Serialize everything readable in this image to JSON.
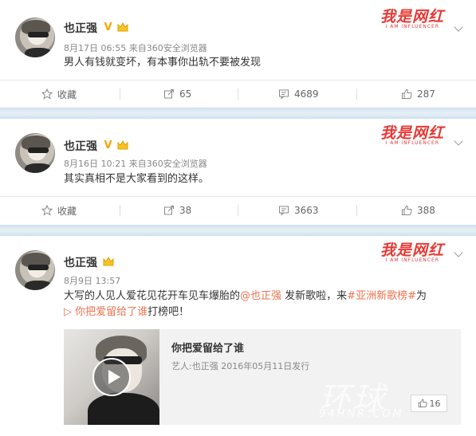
{
  "posts": [
    {
      "author": "也正强",
      "verified_badge": "V",
      "date": "8月17日 06:55",
      "source_prefix": "来自",
      "source": "360安全浏览器",
      "text": "男人有钱就变坏，有本事你出轨不要被发现",
      "watermark": "我是网红",
      "watermark_sub": "I AM INFLUENCER",
      "actions": {
        "favorite": "收藏",
        "repost": "65",
        "comment": "4689",
        "like": "287"
      }
    },
    {
      "author": "也正强",
      "verified_badge": "V",
      "date": "8月16日 10:21",
      "source_prefix": "来自",
      "source": "360安全浏览器",
      "text": "其实真相不是大家看到的这样。",
      "watermark": "我是网红",
      "watermark_sub": "I AM INFLUENCER",
      "actions": {
        "favorite": "收藏",
        "repost": "38",
        "comment": "3663",
        "like": "388"
      }
    },
    {
      "author": "也正强",
      "date": "8月9日 13:57",
      "text_part1": "大写的人见人爱花见花开车见车爆胎的",
      "mention": "@也正强",
      "text_part2": " 发新歌啦，来",
      "hashtag": "#亚洲新歌榜#",
      "text_part3": "为",
      "song_link": "▷ 你把爱留给了谁",
      "text_part4": "打榜吧！",
      "watermark": "我是网红",
      "watermark_sub": "I AM INFLUENCER",
      "music_card": {
        "title": "你把爱留给了谁",
        "artist": "艺人:也正强 2016年05月11日发行",
        "like_count": "16"
      }
    }
  ],
  "site_watermark": "环球",
  "site_watermark_url": "94HNR.COM",
  "colors": {
    "accent": "#eb7350",
    "watermark": "#e53935",
    "separator": "#d5e5ef"
  }
}
